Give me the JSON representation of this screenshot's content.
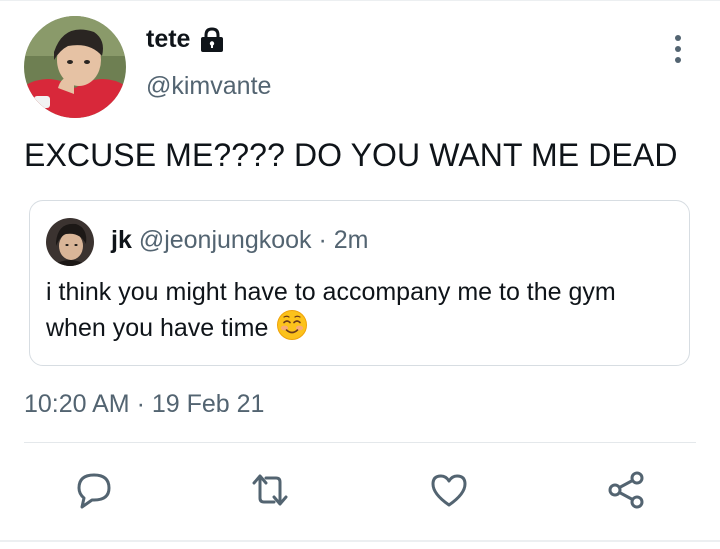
{
  "author": {
    "display_name": "tete",
    "handle": "@kimvante",
    "protected": true
  },
  "tweet": {
    "text": "EXCUSE ME???? DO YOU WANT ME DEAD",
    "timestamp": "10:20 AM · 19 Feb 21"
  },
  "quoted_tweet": {
    "display_name": "jk",
    "handle": "@jeonjungkook",
    "time_ago": "· 2m",
    "text": "i think you might have to accompany me to the gym when you have time",
    "emoji": "smiling-face-with-smiling-eyes"
  },
  "actions": [
    {
      "name": "reply",
      "icon": "reply-icon"
    },
    {
      "name": "retweet",
      "icon": "retweet-icon"
    },
    {
      "name": "like",
      "icon": "heart-icon"
    },
    {
      "name": "share",
      "icon": "share-icon"
    }
  ],
  "colors": {
    "text_primary": "#0f1419",
    "text_secondary": "#536471",
    "icon": "#536471",
    "border": "#d7dde2"
  }
}
